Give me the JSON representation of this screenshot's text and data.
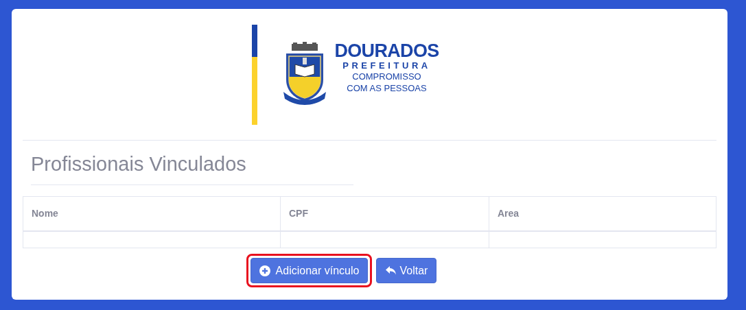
{
  "logo": {
    "name": "DOURADOS",
    "subtitle": "PREFEITURA",
    "tagline_lines": [
      "COMPROMISSO",
      "COM AS PESSOAS"
    ]
  },
  "title": "Profissionais Vinculados",
  "table": {
    "columns": [
      "Nome",
      "CPF",
      "Area"
    ]
  },
  "buttons": [
    {
      "kind": "add",
      "label": "Adicionar vínculo",
      "highlighted": true
    },
    {
      "kind": "back",
      "label": "Voltar",
      "highlighted": false
    }
  ]
}
